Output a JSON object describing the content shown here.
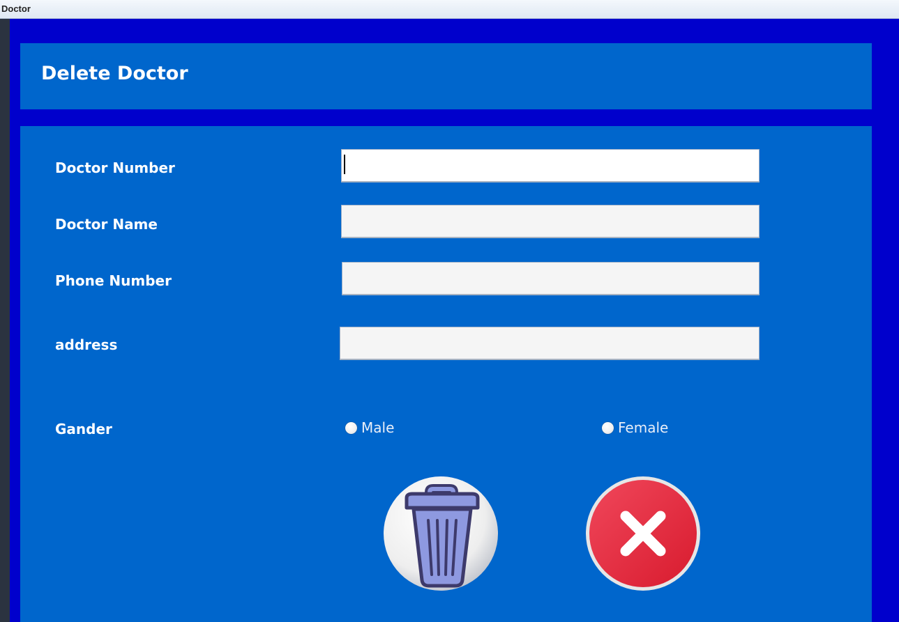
{
  "window": {
    "title": "Doctor"
  },
  "header": {
    "title": "Delete Doctor"
  },
  "form": {
    "fields": [
      {
        "label": "Doctor Number",
        "value": ""
      },
      {
        "label": "Doctor Name",
        "value": ""
      },
      {
        "label": "Phone Number",
        "value": ""
      },
      {
        "label": "address",
        "value": ""
      }
    ],
    "gender": {
      "label": "Gander",
      "options": [
        "Male",
        "Female"
      ],
      "selected": null
    }
  },
  "actions": {
    "delete_icon": "trash-can-icon",
    "cancel_icon": "close-x-icon"
  },
  "colors": {
    "background": "#0000cc",
    "panel": "#0066cc",
    "field": "#f5f5f5",
    "cancel_red": "#e8263a",
    "trash_purple": "#8e99e0"
  }
}
